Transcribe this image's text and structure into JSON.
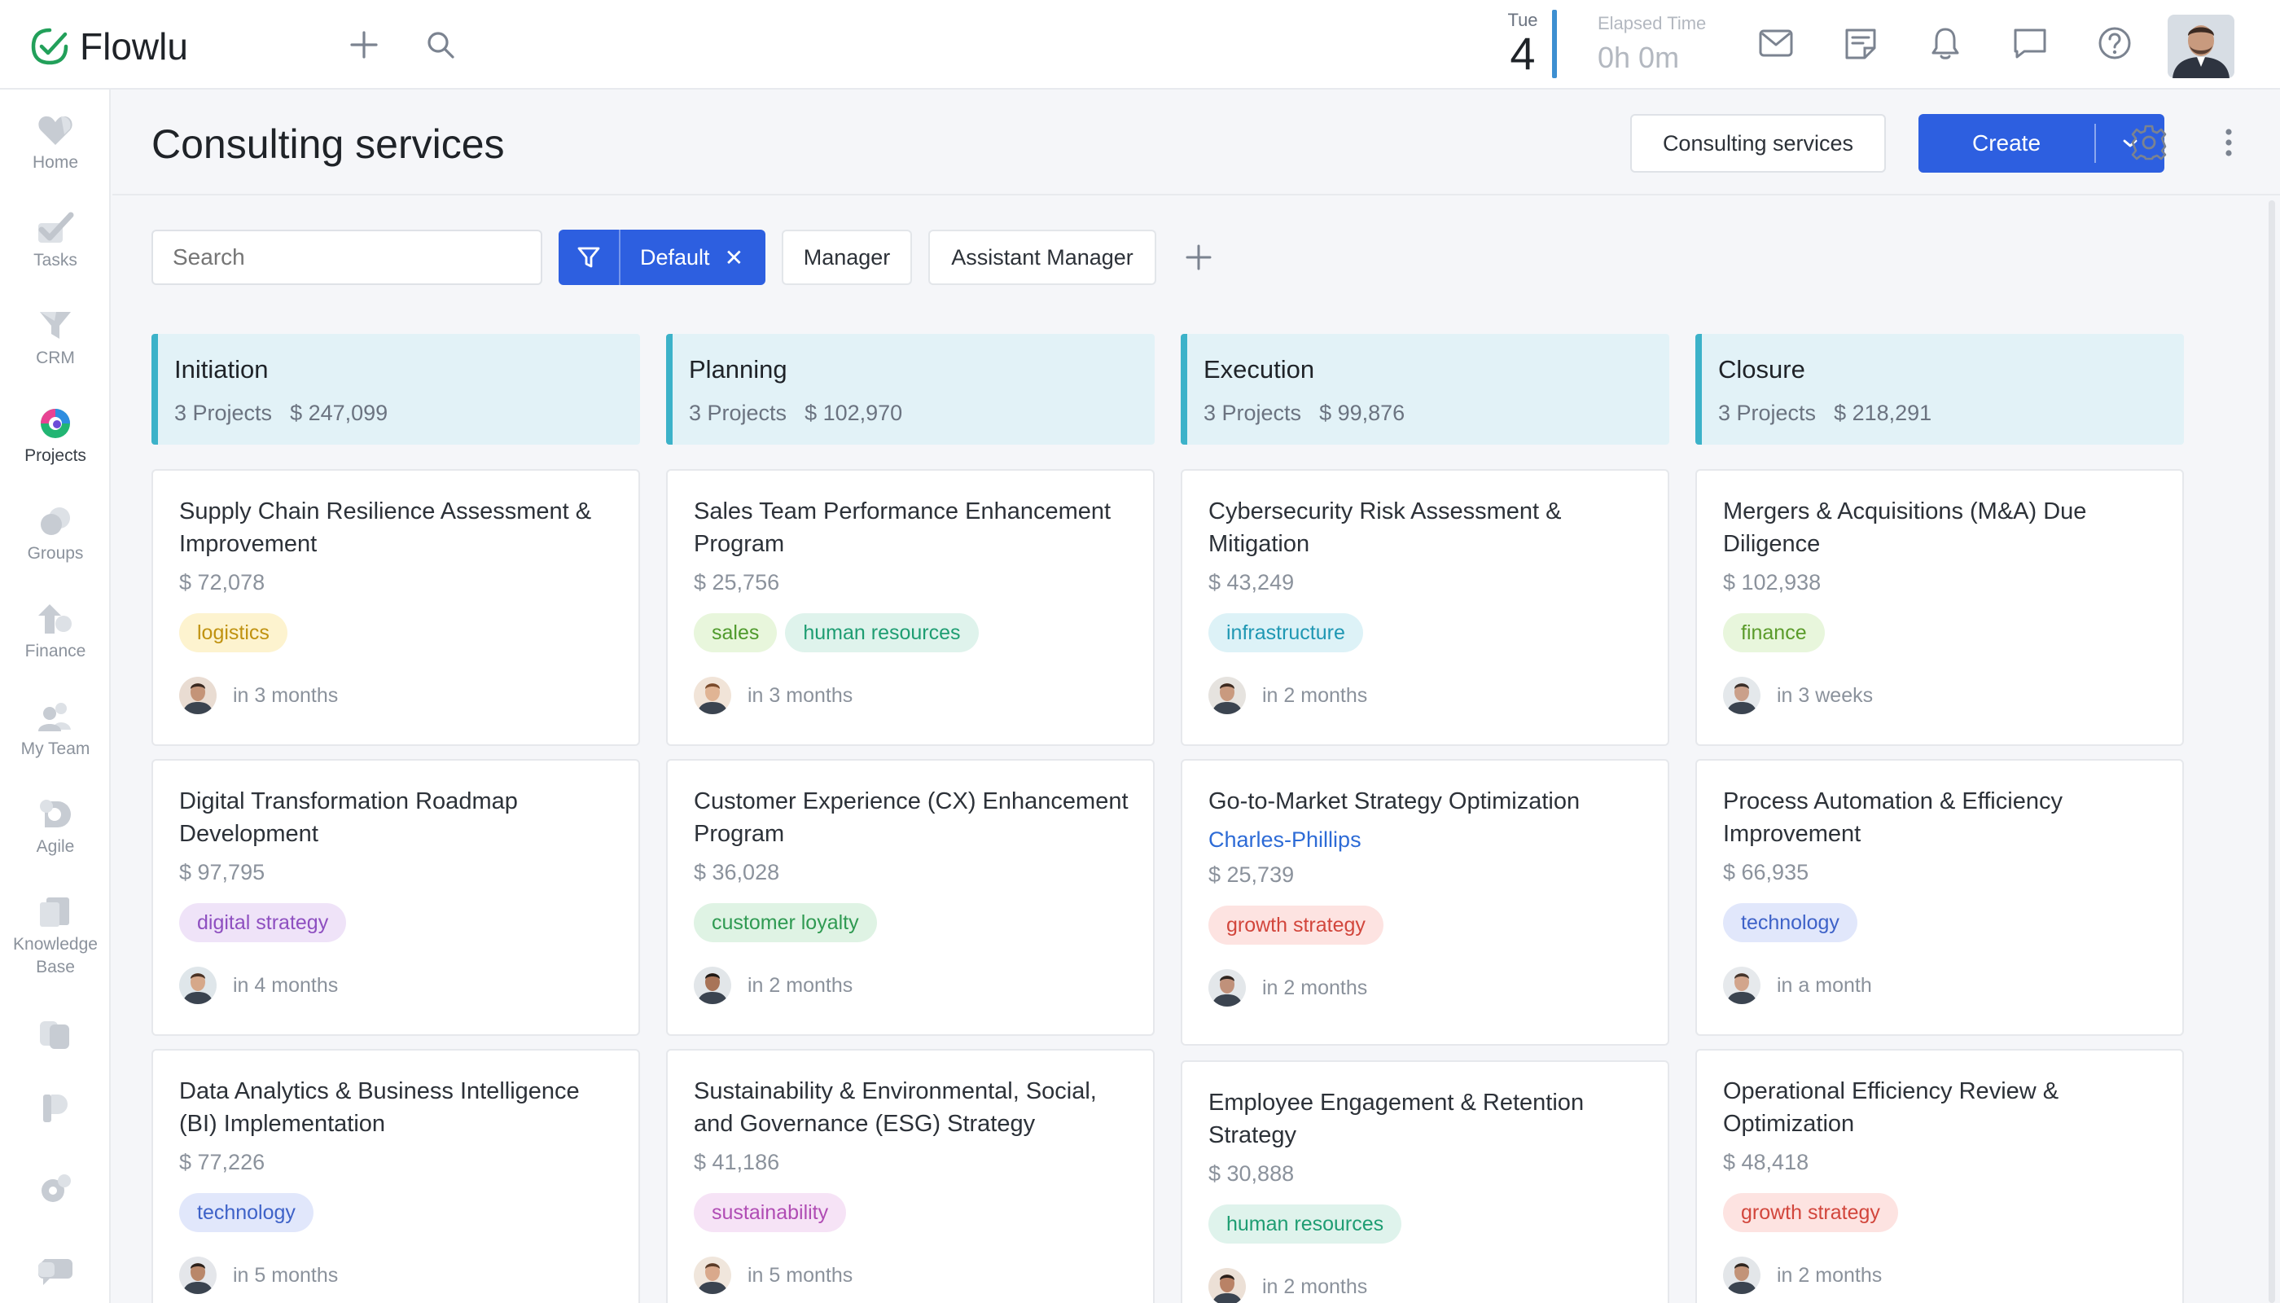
{
  "app": {
    "name": "Flowlu",
    "date_day": "Tue",
    "date_num": "4",
    "elapsed_label": "Elapsed Time",
    "elapsed_value": "0h 0m"
  },
  "sidebar": {
    "items": [
      {
        "label": "Home",
        "icon": "heart-icon"
      },
      {
        "label": "Tasks",
        "icon": "check-icon"
      },
      {
        "label": "CRM",
        "icon": "funnel-icon"
      },
      {
        "label": "Projects",
        "icon": "projects-icon"
      },
      {
        "label": "Groups",
        "icon": "groups-icon"
      },
      {
        "label": "Finance",
        "icon": "finance-icon"
      },
      {
        "label": "My Team",
        "icon": "team-icon"
      },
      {
        "label": "Agile",
        "icon": "agile-icon"
      },
      {
        "label": "Knowledge Base",
        "icon": "book-icon"
      }
    ]
  },
  "header": {
    "title": "Consulting services",
    "pipeline_button": "Consulting services",
    "create_button": "Create"
  },
  "filters": {
    "search_placeholder": "Search",
    "active_filter": "Default",
    "chips": [
      "Manager",
      "Assistant Manager"
    ]
  },
  "columns": [
    {
      "title": "Initiation",
      "count": "3 Projects",
      "total": "$ 247,099"
    },
    {
      "title": "Planning",
      "count": "3 Projects",
      "total": "$ 102,970"
    },
    {
      "title": "Execution",
      "count": "3 Projects",
      "total": "$ 99,876"
    },
    {
      "title": "Closure",
      "count": "3 Projects",
      "total": "$ 218,291"
    }
  ],
  "cards": [
    {
      "title": "Supply Chain Resilience Assessment & Improvement",
      "amount": "$ 72,078",
      "tags": [
        "logistics"
      ],
      "due": "in 3 months"
    },
    {
      "title": "Digital Transformation Roadmap Development",
      "amount": "$ 97,795",
      "tags": [
        "digital strategy"
      ],
      "due": "in 4 months"
    },
    {
      "title": "Data Analytics & Business Intelligence (BI) Implementation",
      "amount": "$ 77,226",
      "tags": [
        "technology"
      ],
      "due": "in 5 months"
    },
    {
      "title": "Sales Team Performance Enhancement Program",
      "amount": "$ 25,756",
      "tags": [
        "sales",
        "human resources"
      ],
      "due": "in 3 months"
    },
    {
      "title": "Customer Experience (CX) Enhancement Program",
      "amount": "$ 36,028",
      "tags": [
        "customer loyalty"
      ],
      "due": "in 2 months"
    },
    {
      "title": "Sustainability & Environmental, Social, and Governance (ESG) Strategy",
      "amount": "$ 41,186",
      "tags": [
        "sustainability"
      ],
      "due": "in 5 months"
    },
    {
      "title": "Cybersecurity Risk Assessment & Mitigation",
      "amount": "$ 43,249",
      "tags": [
        "infrastructure"
      ],
      "due": "in 2 months"
    },
    {
      "title": "Go-to-Market Strategy Optimization",
      "link": "Charles-Phillips",
      "amount": "$ 25,739",
      "tags": [
        "growth strategy"
      ],
      "due": "in 2 months"
    },
    {
      "title": "Employee Engagement & Retention Strategy",
      "amount": "$ 30,888",
      "tags": [
        "human resources"
      ],
      "due": "in 2 months"
    },
    {
      "title": "Mergers & Acquisitions (M&A) Due Diligence",
      "amount": "$ 102,938",
      "tags": [
        "finance"
      ],
      "due": "in 3 weeks"
    },
    {
      "title": "Process Automation & Efficiency Improvement",
      "amount": "$ 66,935",
      "tags": [
        "technology"
      ],
      "due": "in a month"
    },
    {
      "title": "Operational Efficiency Review & Optimization",
      "amount": "$ 48,418",
      "tags": [
        "growth strategy"
      ],
      "due": "in 2 months"
    }
  ],
  "colors": {
    "accent": "#2d5fe0",
    "column_header_bg": "#e2f2f7",
    "column_header_border": "#3cb2c9"
  }
}
